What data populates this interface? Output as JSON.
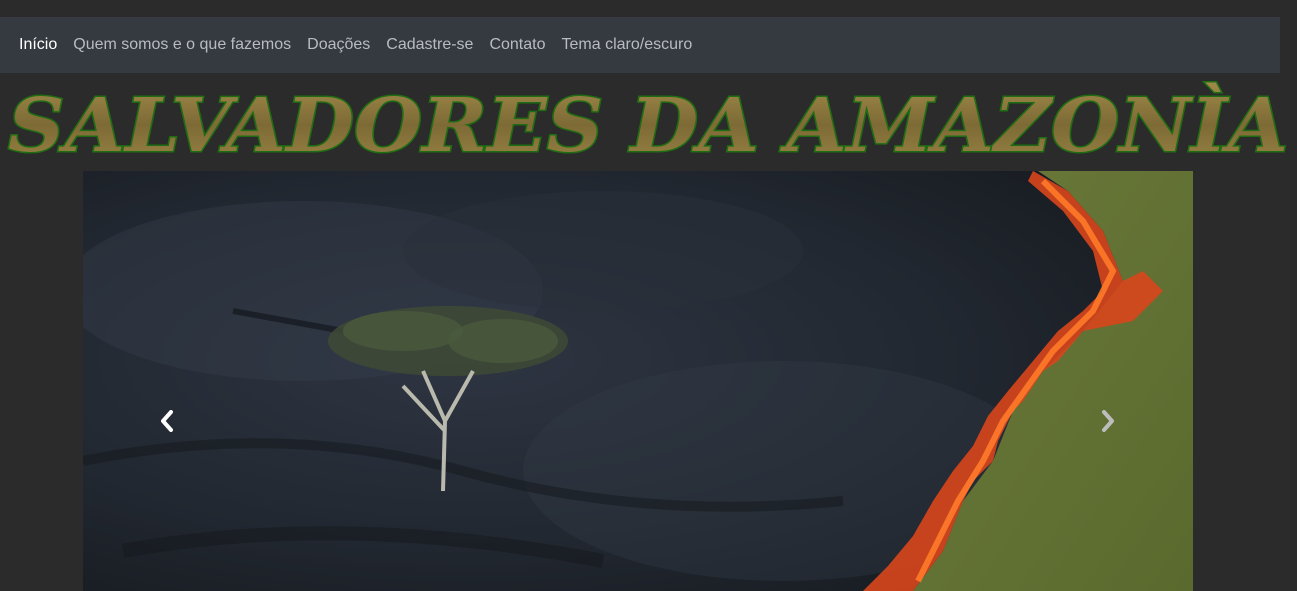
{
  "nav": {
    "items": [
      {
        "label": "Início",
        "active": true
      },
      {
        "label": "Quem somos e o que fazemos",
        "active": false
      },
      {
        "label": "Doações",
        "active": false
      },
      {
        "label": "Cadastre-se",
        "active": false
      },
      {
        "label": "Contato",
        "active": false
      },
      {
        "label": "Tema claro/escuro",
        "active": false
      }
    ]
  },
  "banner": {
    "title": "SALVADORES DA AMAZONÌA"
  },
  "carousel": {
    "prev_icon": "chevron-left-icon",
    "next_icon": "chevron-right-icon"
  },
  "colors": {
    "page_bg": "#2b2b2b",
    "navbar_bg": "#343a40",
    "nav_text": "#b8bcc0",
    "nav_active": "#ffffff",
    "banner_fill": "#8a7a3c",
    "banner_stroke": "#1f6d12"
  }
}
